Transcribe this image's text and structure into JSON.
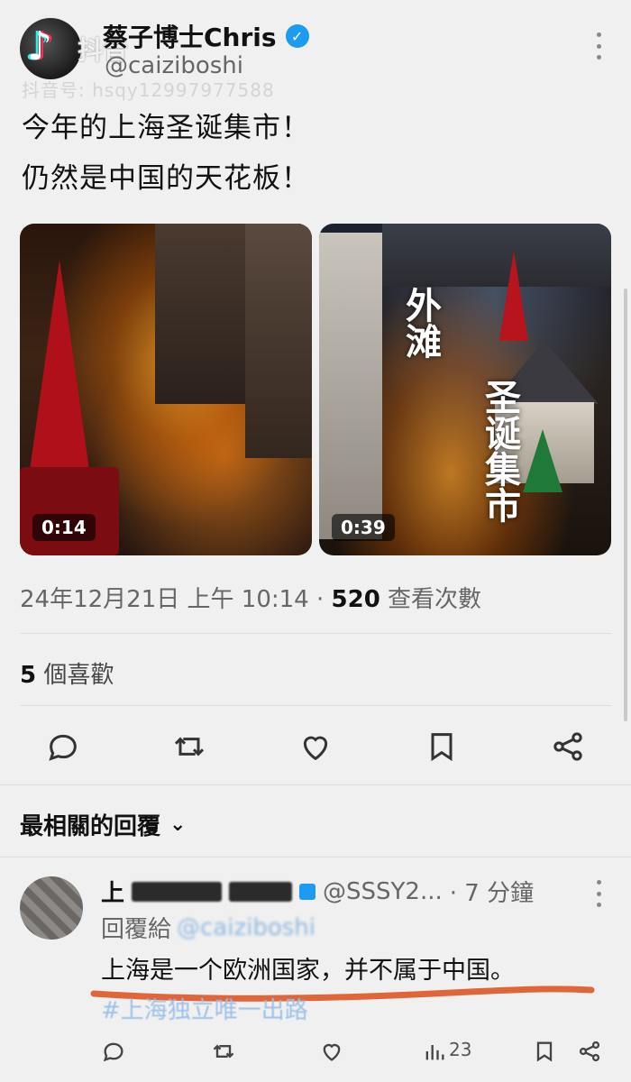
{
  "watermark": {
    "platform": "抖音",
    "id": "抖音号: hsqy12997977588"
  },
  "tweet": {
    "author_name": "蔡子博士Chris",
    "author_handle": "@caiziboshi",
    "lines": [
      "今年的上海圣诞集市！",
      "仍然是中国的天花板！"
    ],
    "media": [
      {
        "duration": "0:14"
      },
      {
        "duration": "0:39",
        "overlay_1": "外滩",
        "overlay_2": "圣诞集市"
      }
    ],
    "timestamp": "24年12月21日 上午 10:14 · ",
    "views_count": "520",
    "views_label": " 查看次數",
    "likes_count": "5",
    "likes_label": " 個喜歡"
  },
  "actions": {
    "icons": [
      "reply-icon",
      "retweet-icon",
      "like-icon",
      "bookmark-icon",
      "share-icon"
    ]
  },
  "replies": {
    "sort_label": "最相關的回覆",
    "items": [
      {
        "author_name_visible": "上",
        "handle": "@SSSY2...",
        "time": "· 7 分鐘",
        "reply_to_label": "回覆給",
        "reply_to_handle": "@caiziboshi",
        "text": "上海是一个欧洲国家，并不属于中国。",
        "hashtag": "#上海独立唯一出路",
        "views": "23"
      }
    ]
  },
  "colors": {
    "verified": "#1d9bf0",
    "underline": "#e0663a",
    "text_primary": "#111111",
    "text_secondary": "#666666"
  }
}
